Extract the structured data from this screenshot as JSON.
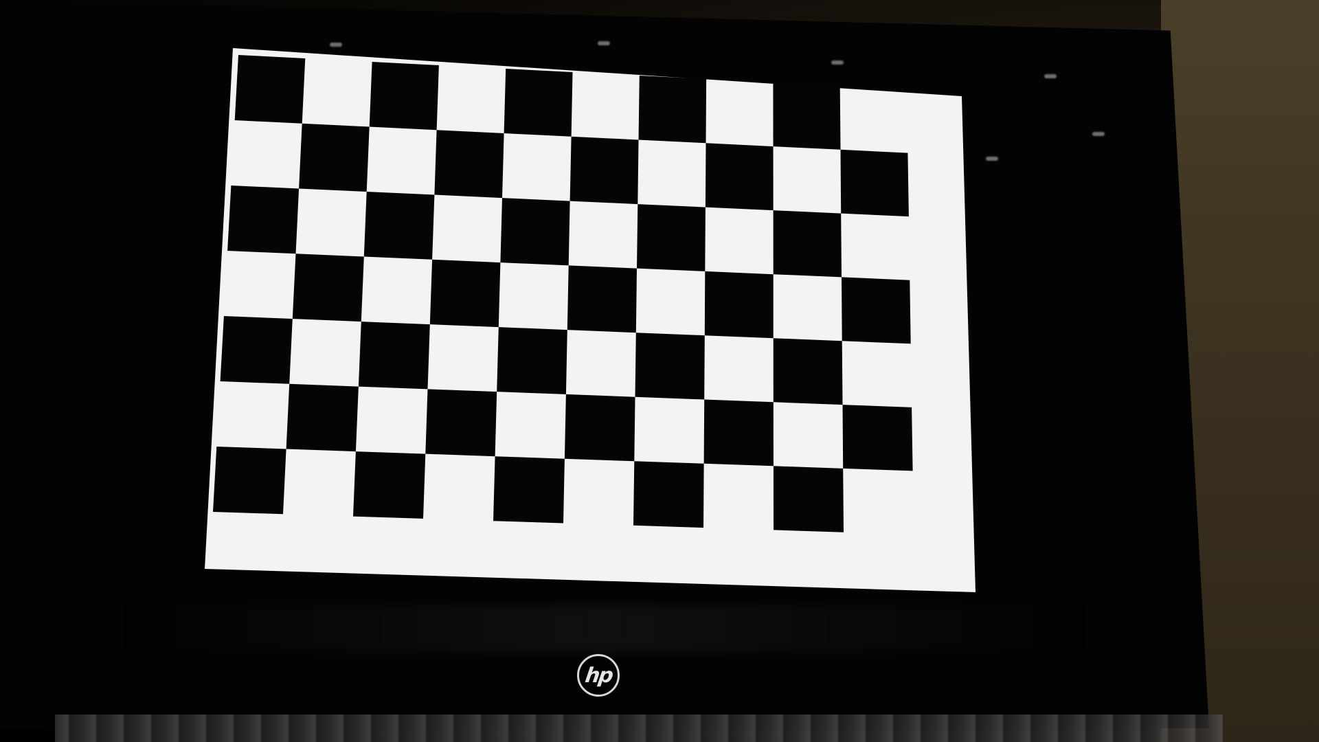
{
  "scene": {
    "description_free": true,
    "brand_logo_text": "hp"
  },
  "checkerboard": {
    "rows": 7,
    "cols": 10,
    "top_left_color": "black",
    "dark_color": "#050505",
    "light_color": "#f1f1f3"
  },
  "colors": {
    "screen_background": "#f3f3f5",
    "bezel": "#030303",
    "wall": "#3c3220"
  }
}
